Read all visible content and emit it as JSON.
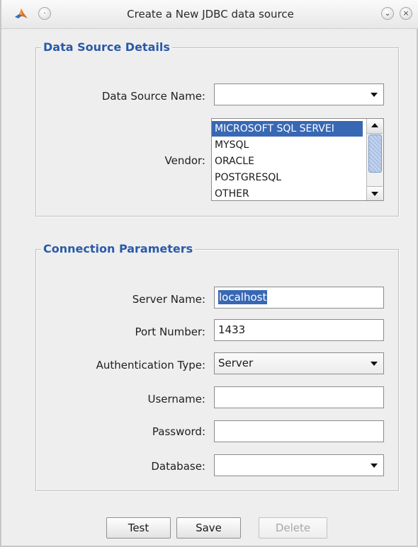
{
  "window": {
    "title": "Create a New JDBC data source",
    "icon": "matlab-icon"
  },
  "data_source_panel": {
    "title": "Data Source Details",
    "name_label": "Data Source Name:",
    "name_value": "",
    "vendor_label": "Vendor:",
    "vendors": [
      "MICROSOFT SQL SERVEI",
      "MYSQL",
      "ORACLE",
      "POSTGRESQL",
      "OTHER"
    ],
    "selected_vendor_index": 0
  },
  "connection_panel": {
    "title": "Connection Parameters",
    "server_label": "Server Name:",
    "server_value": "localhost",
    "port_label": "Port Number:",
    "port_value": "1433",
    "auth_label": "Authentication Type:",
    "auth_value": "Server",
    "username_label": "Username:",
    "username_value": "",
    "password_label": "Password:",
    "password_value": "",
    "database_label": "Database:",
    "database_value": ""
  },
  "buttons": {
    "test": "Test",
    "save": "Save",
    "delete": "Delete"
  },
  "colors": {
    "accent": "#3868b4",
    "panel_title": "#2a5aa8",
    "window_bg": "#eeeeee"
  }
}
